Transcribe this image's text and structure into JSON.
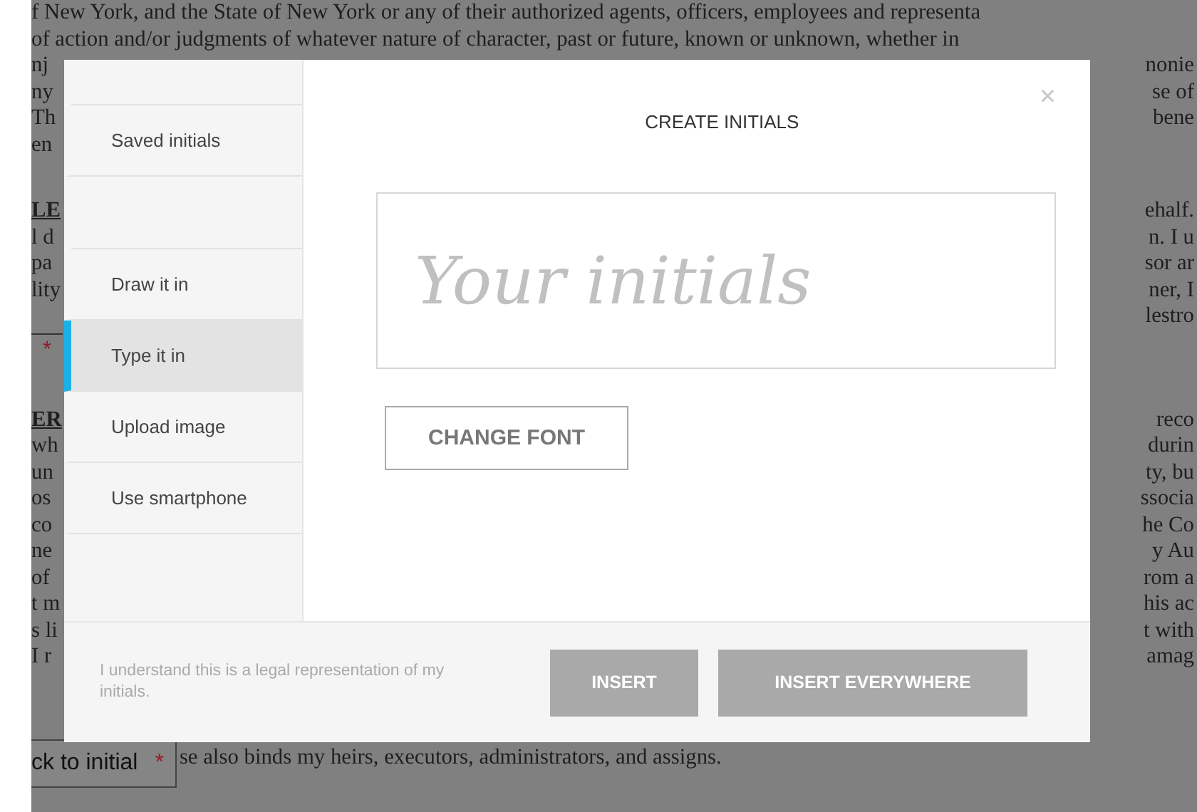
{
  "document": {
    "paragraphs": [
      {
        "rows": [
          {
            "kind": "full",
            "text": "f New York, and the State of New York  or any of their authorized agents, officers, employees and representa"
          },
          {
            "kind": "full",
            "text": "of action and/or judgments of whatever nature of character, past or future, known or unknown, whether in"
          },
          {
            "kind": "split",
            "left": "nj",
            "right": "nonie"
          },
          {
            "kind": "split",
            "left": "ny",
            "right": "se of"
          },
          {
            "kind": "split",
            "left": "Th",
            "right": "bene"
          },
          {
            "kind": "split",
            "left": "en"
          }
        ]
      },
      {
        "rows": [
          {
            "kind": "heading",
            "left": "LE",
            "right": "ehalf."
          },
          {
            "kind": "split",
            "left": "l d",
            "right": "n. I u"
          },
          {
            "kind": "split",
            "left": "pa",
            "right": "sor ar"
          },
          {
            "kind": "split",
            "left": "lity",
            "right": "ner, I"
          },
          {
            "kind": "split",
            "right": "lestro"
          },
          {
            "kind": "initial",
            "left": "*"
          }
        ]
      },
      {
        "rows": [
          {
            "kind": "heading",
            "left": "ER",
            "right": "reco"
          },
          {
            "kind": "split",
            "left": "wh",
            "right": "durin"
          },
          {
            "kind": "split",
            "left": "un",
            "right": "ty, bu"
          },
          {
            "kind": "split",
            "left": "os",
            "right": "ssocia"
          },
          {
            "kind": "split",
            "left": "co",
            "right": "he Co"
          },
          {
            "kind": "split",
            "left": "ne",
            "right": "y Au"
          },
          {
            "kind": "split",
            "left": "of",
            "right": "rom a"
          },
          {
            "kind": "split",
            "left": "t m",
            "right": "his ac"
          },
          {
            "kind": "split",
            "left": "s li",
            "right": "t with"
          },
          {
            "kind": "split",
            "left": "I r",
            "right": "amag"
          }
        ]
      }
    ],
    "back_button": {
      "label": "ck to initial",
      "required_mark": "*"
    },
    "last_line": "se also binds my heirs, executors, administrators, and assigns."
  },
  "dialog": {
    "title": "CREATE INITIALS",
    "close": "×",
    "sidebar": {
      "groups": [
        [
          {
            "label": "Saved initials",
            "selected": false
          }
        ],
        [
          {
            "label": "Draw it in",
            "selected": false
          },
          {
            "label": "Type it in",
            "selected": true
          },
          {
            "label": "Upload image",
            "selected": false
          },
          {
            "label": "Use smartphone",
            "selected": false
          }
        ]
      ]
    },
    "initials_field": {
      "placeholder": "Your initials"
    },
    "change_font_button": "CHANGE FONT",
    "consent_text": "I understand this is a legal representation of my initials.",
    "buttons": [
      {
        "label": "INSERT",
        "disabled": true
      },
      {
        "label": "INSERT EVERYWHERE",
        "disabled": true
      }
    ]
  }
}
